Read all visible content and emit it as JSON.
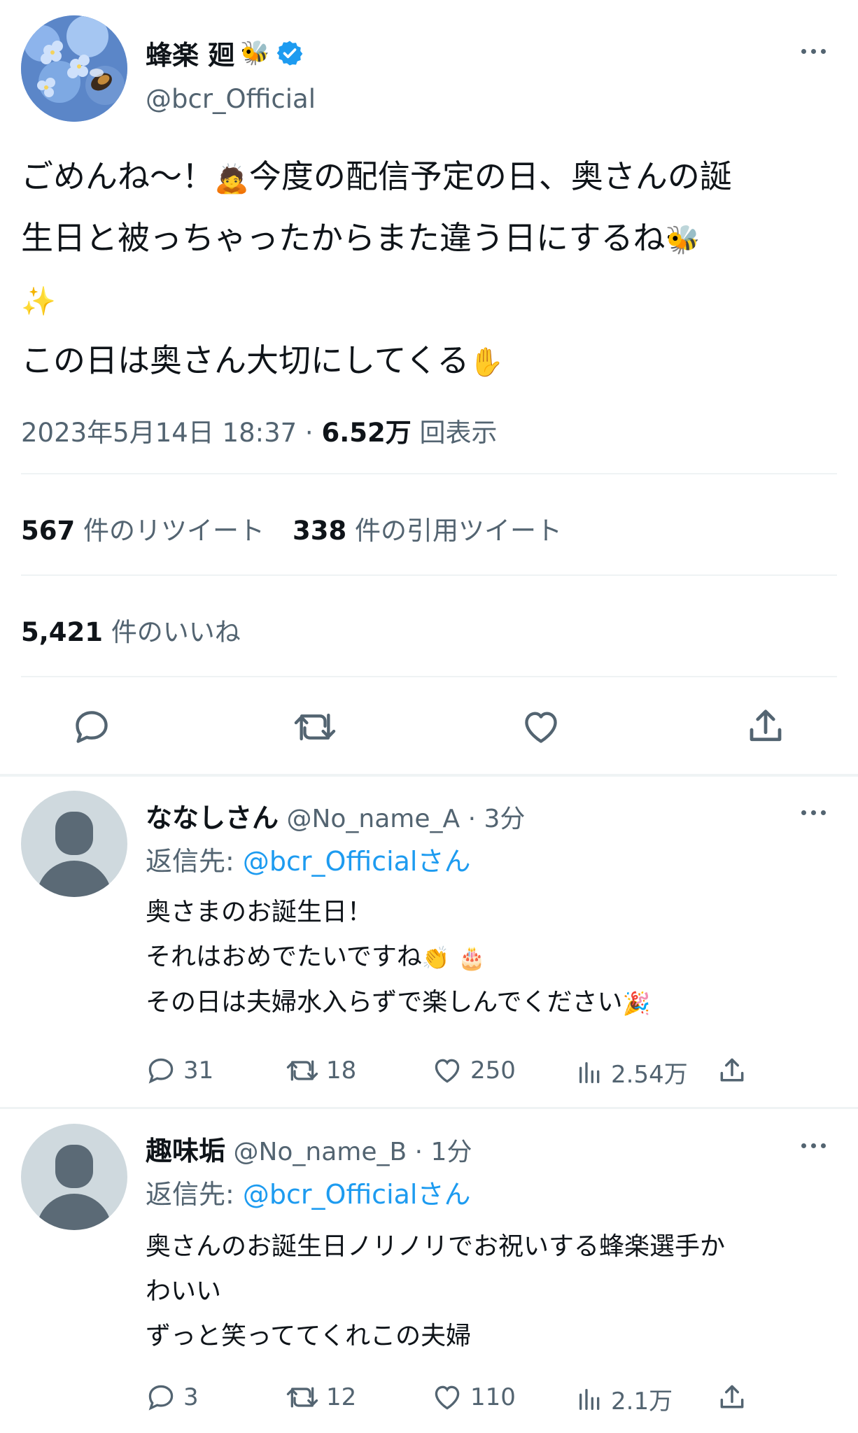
{
  "tweet": {
    "author_name": "蜂楽 廻",
    "author_emoji": "🐝",
    "handle": "@bcr_Official",
    "body_line1": "ごめんね〜！",
    "body_line1_rest": "今度の配信予定の日、奥さんの誕",
    "body_line2": "生日と被っちゃったからまた違う日にするね",
    "body_line3": "この日は奥さん大切にしてくる",
    "date": "2023年5月14日 18:37 · ",
    "views_count": "6.52万",
    "views_label": " 回表示",
    "retweets_count": "567",
    "retweets_label": "件のリツイート",
    "quotes_count": "338",
    "quotes_label": "件の引用ツイート",
    "likes_count": "5,421",
    "likes_label": "件のいいね",
    "icons": [
      "reply-icon",
      "retweet-icon",
      "like-icon",
      "share-icon",
      "more-icon",
      "verified-badge-icon"
    ]
  },
  "replies": [
    {
      "name": "ななしさん",
      "handle_time": "@No_name_A · 3分",
      "reply_to_label": "返信先: ",
      "reply_to_user": "@bcr_Officialさん",
      "lines": [
        "奥さまのお誕生日！",
        "それはおめでたいですね",
        "その日は夫婦水入らずで楽しんでください"
      ],
      "replies": "31",
      "retweets": "18",
      "likes": "250",
      "views": "2.54万"
    },
    {
      "name": "趣味垢",
      "handle_time": "@No_name_B · 1分",
      "reply_to_label": "返信先: ",
      "reply_to_user": "@bcr_Officialさん",
      "lines": [
        "奥さんのお誕生日ノリノリでお祝いする蜂楽選手か",
        "わいい",
        "ずっと笑っててくれこの夫婦"
      ],
      "replies": "3",
      "retweets": "12",
      "likes": "110",
      "views": "2.1万"
    }
  ],
  "colors": {
    "link": "#1d9bf0",
    "secondary": "#536471",
    "text": "#0f1419",
    "verified": "#1d9bf0"
  }
}
